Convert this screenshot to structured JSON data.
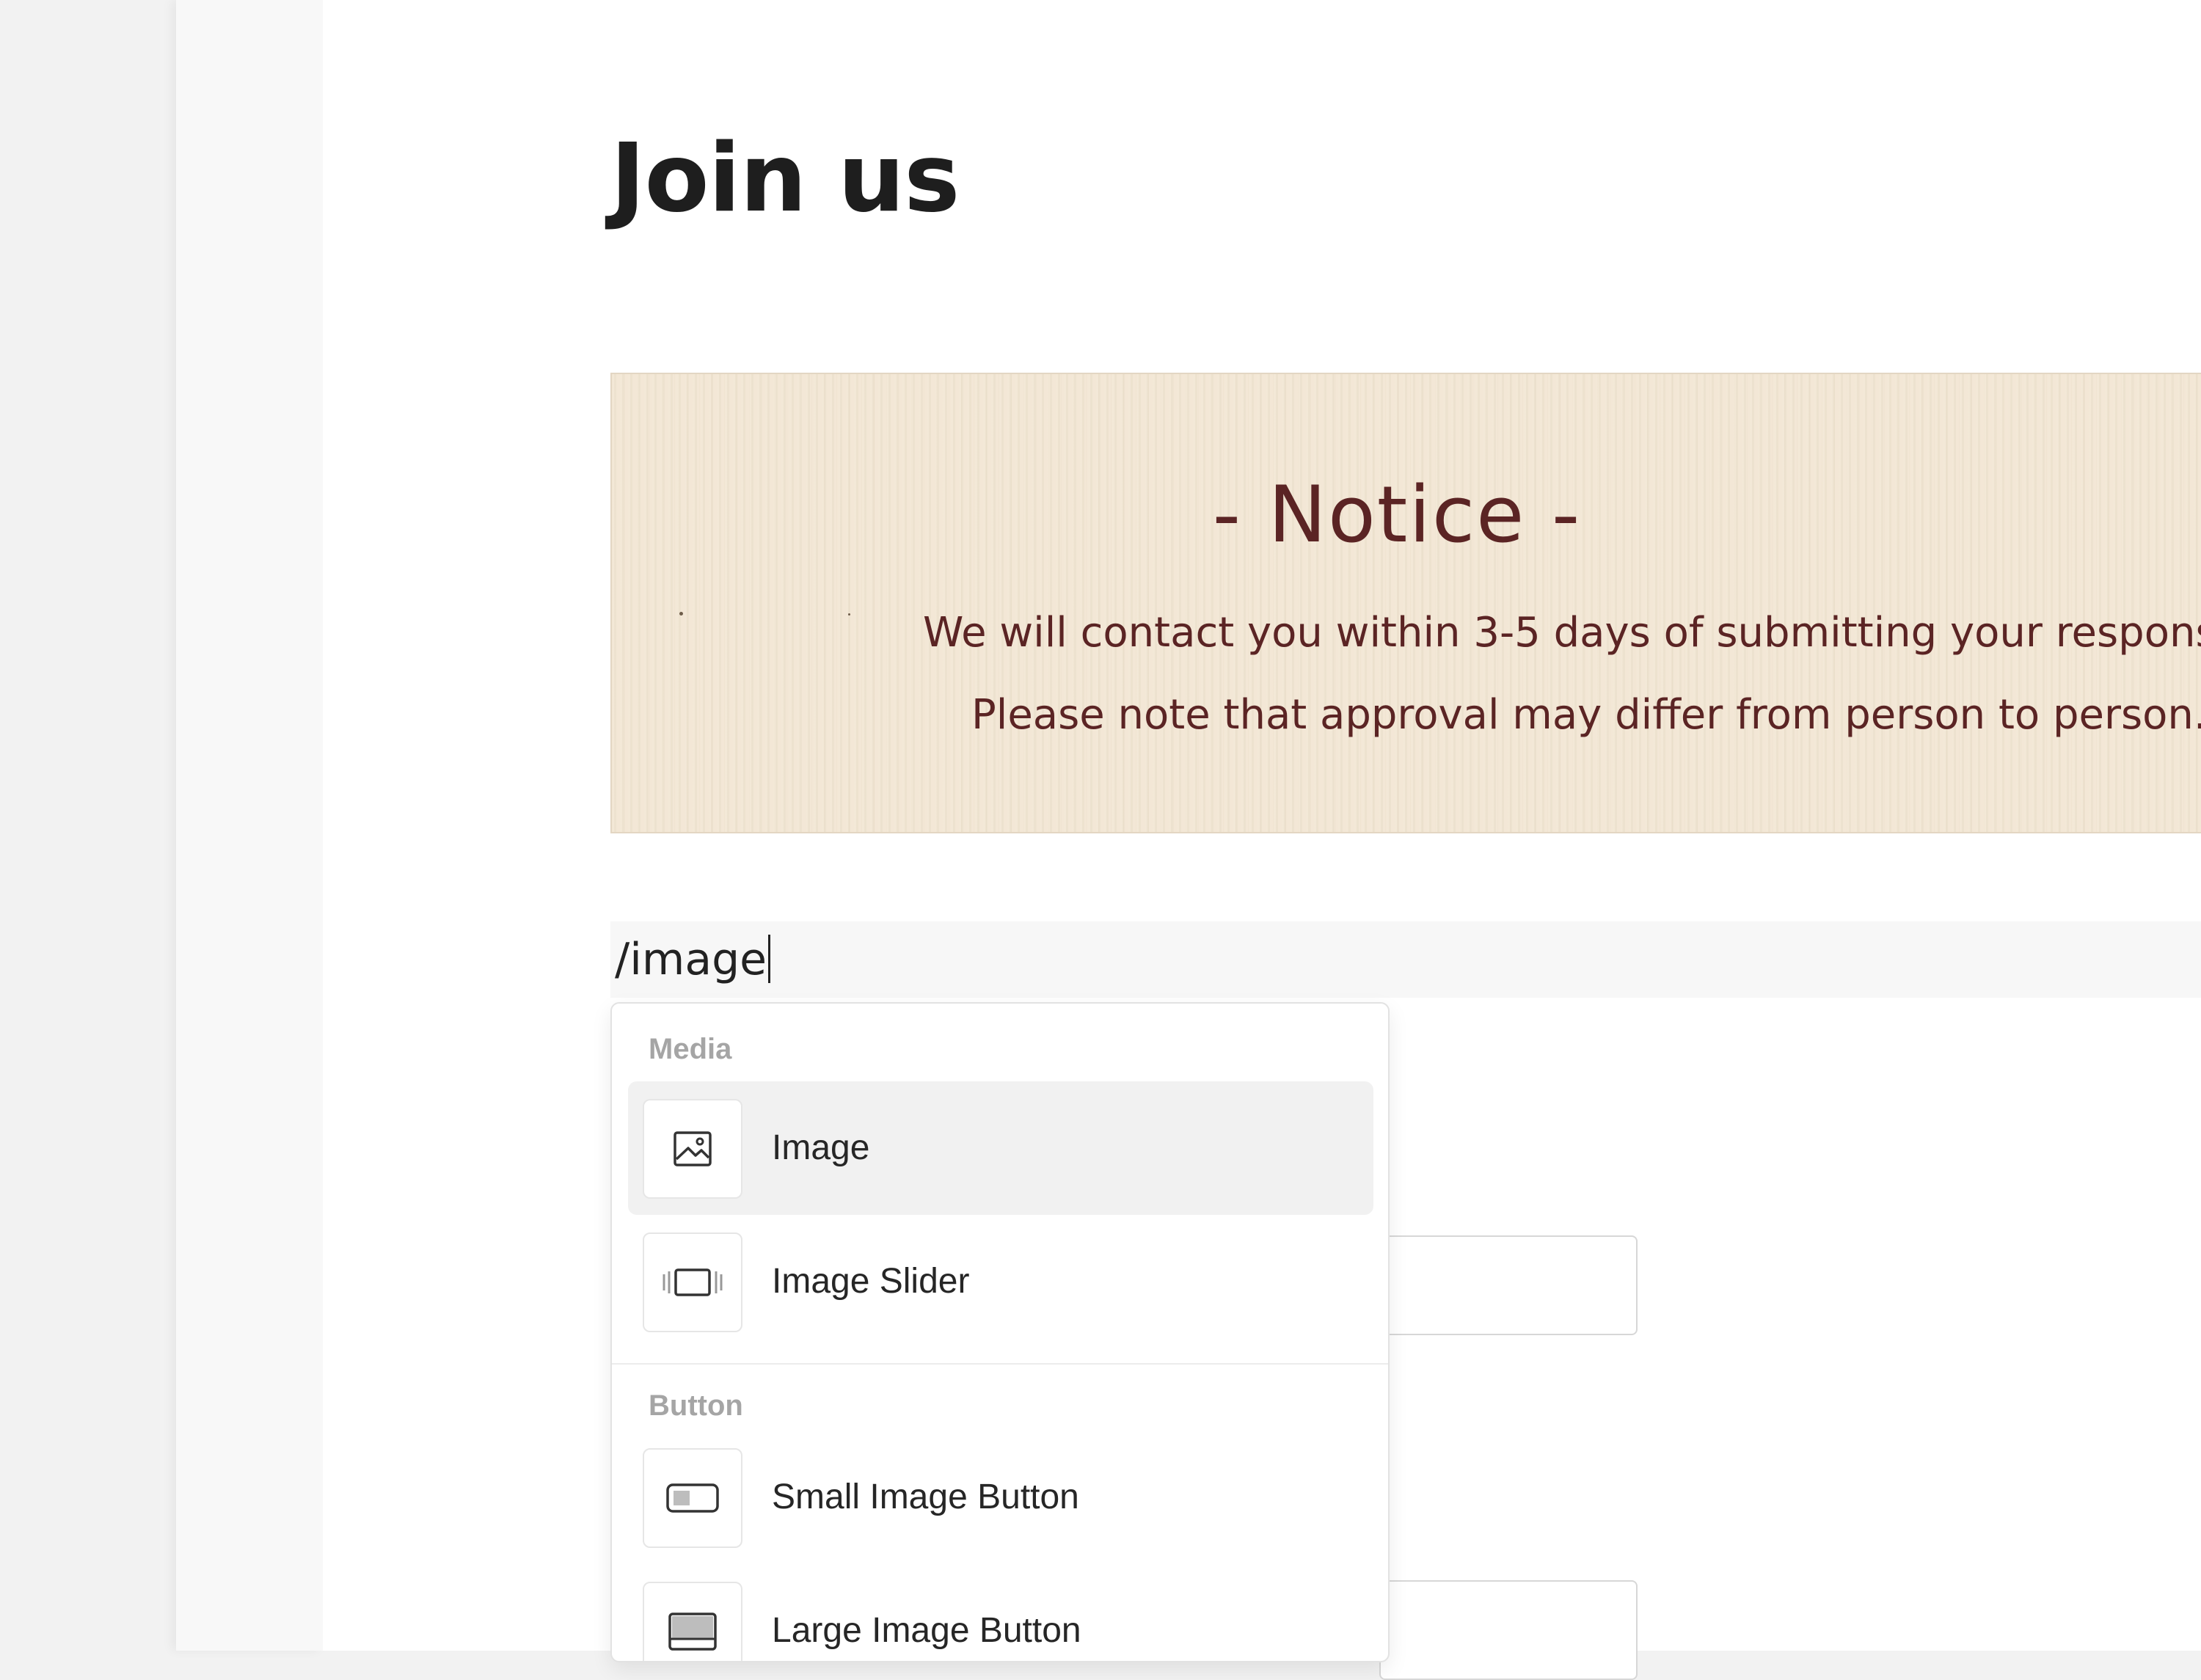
{
  "page": {
    "title": "Join us"
  },
  "notice": {
    "heading": "- Notice -",
    "line1": "We will contact you within 3-5 days of submitting your respons",
    "line2": "Please note that approval may differ from person to person."
  },
  "command": {
    "value": "/image"
  },
  "menu": {
    "sections": [
      {
        "label": "Media",
        "items": [
          {
            "label": "Image",
            "icon": "image-icon",
            "selected": true
          },
          {
            "label": "Image Slider",
            "icon": "image-slider-icon",
            "selected": false
          }
        ]
      },
      {
        "label": "Button",
        "items": [
          {
            "label": "Small Image Button",
            "icon": "small-image-button-icon",
            "selected": false
          },
          {
            "label": "Large Image Button",
            "icon": "large-image-button-icon",
            "selected": false
          }
        ]
      }
    ]
  },
  "colors": {
    "notice_text": "#5b2424",
    "notice_background": "#f2e6d3",
    "selected_item_background": "#f1f1f1"
  }
}
